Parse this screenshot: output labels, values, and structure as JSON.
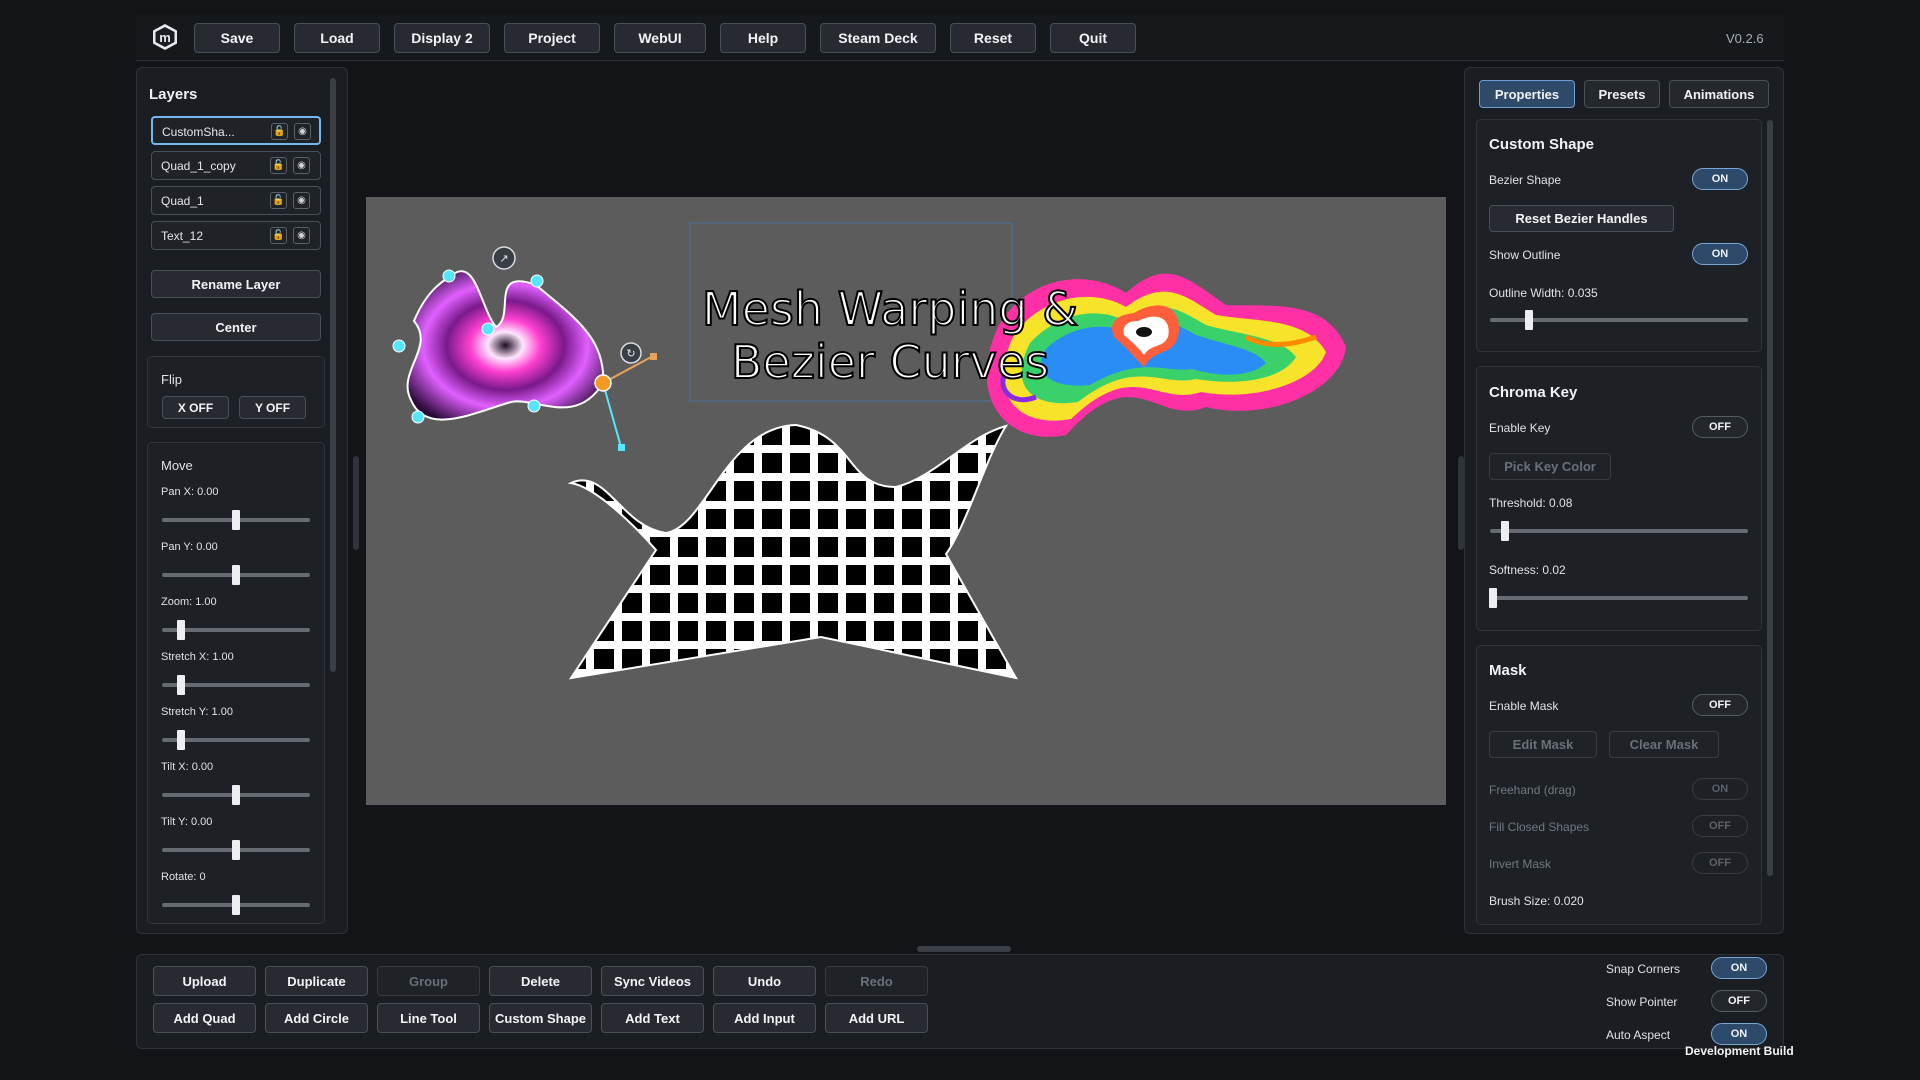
{
  "toolbar": {
    "save": "Save",
    "load": "Load",
    "display": "Display 2",
    "project": "Project",
    "webui": "WebUI",
    "help": "Help",
    "steam_deck": "Steam Deck",
    "reset": "Reset",
    "quit": "Quit",
    "version": "V0.2.6"
  },
  "layers": {
    "title": "Layers",
    "items": [
      {
        "name": "CustomSha..."
      },
      {
        "name": "Quad_1_copy"
      },
      {
        "name": "Quad_1"
      },
      {
        "name": "Text_12"
      }
    ],
    "rename": "Rename Layer",
    "center": "Center",
    "flip": {
      "title": "Flip",
      "x": "X OFF",
      "y": "Y OFF"
    },
    "move": {
      "title": "Move",
      "sliders": [
        {
          "label": "Pan X: 0.00",
          "value": 0.5
        },
        {
          "label": "Pan Y: 0.00",
          "value": 0.5
        },
        {
          "label": "Zoom: 1.00",
          "value": 0.13
        },
        {
          "label": "Stretch X: 1.00",
          "value": 0.13
        },
        {
          "label": "Stretch Y: 1.00",
          "value": 0.13
        },
        {
          "label": "Tilt X: 0.00",
          "value": 0.5
        },
        {
          "label": "Tilt Y: 0.00",
          "value": 0.5
        },
        {
          "label": "Rotate: 0",
          "value": 0.5
        }
      ]
    }
  },
  "canvas": {
    "title_line1": "Mesh Warping &",
    "title_line2": "Bezier Curves"
  },
  "right": {
    "tabs": [
      "Properties",
      "Presets",
      "Animations"
    ],
    "custom_shape": {
      "title": "Custom Shape",
      "bezier_label": "Bezier Shape",
      "bezier_state": "ON",
      "reset_handles": "Reset Bezier Handles",
      "outline_label": "Show Outline",
      "outline_state": "ON",
      "outline_width_label": "Outline Width: 0.035",
      "outline_width_value": 0.15
    },
    "chroma": {
      "title": "Chroma Key",
      "enable_label": "Enable Key",
      "enable_state": "OFF",
      "pick": "Pick Key Color",
      "threshold_label": "Threshold: 0.08",
      "threshold_value": 0.06,
      "softness_label": "Softness: 0.02",
      "softness_value": 0.01
    },
    "mask": {
      "title": "Mask",
      "enable_label": "Enable Mask",
      "enable_state": "OFF",
      "edit": "Edit Mask",
      "clear": "Clear Mask",
      "freehand_label": "Freehand (drag)",
      "freehand_state": "ON",
      "fill_label": "Fill Closed Shapes",
      "fill_state": "OFF",
      "invert_label": "Invert Mask",
      "invert_state": "OFF",
      "brush_label": "Brush Size: 0.020"
    }
  },
  "bottom": {
    "row1": [
      "Upload",
      "Duplicate",
      "Group",
      "Delete",
      "Sync Videos",
      "Undo",
      "Redo"
    ],
    "row2": [
      "Add Quad",
      "Add Circle",
      "Line Tool",
      "Custom Shape",
      "Add Text",
      "Add Input",
      "Add URL"
    ],
    "snap_label": "Snap Corners",
    "snap_state": "ON",
    "pointer_label": "Show Pointer",
    "pointer_state": "OFF",
    "aspect_label": "Auto Aspect",
    "aspect_state": "ON",
    "build": "Development Build"
  }
}
